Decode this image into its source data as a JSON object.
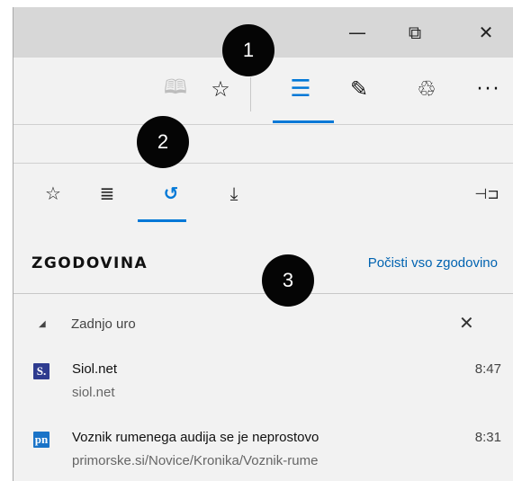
{
  "window_controls": {
    "minimize_icon": "minimize-icon",
    "restore_icon": "restore-icon",
    "close_icon": "close-icon",
    "minimize_glyph": "—",
    "restore_glyph": "⧉",
    "close_glyph": "✕"
  },
  "toolbar": {
    "reading_glyph": "🕮",
    "favorite_glyph": "☆",
    "hub_glyph": "☰",
    "note_glyph": "✎",
    "share_glyph": "♲",
    "more_glyph": "···",
    "accent": "#0078d7"
  },
  "hub_tabs": {
    "favorites_glyph": "☆",
    "reading_list_glyph": "≣",
    "history_glyph": "↺",
    "downloads_glyph": "⤓",
    "pin_glyph": "⊣⊐",
    "active": "history"
  },
  "panel": {
    "title": "ZGODOVINA",
    "clear_link": "Počisti vso zgodovino"
  },
  "group": {
    "caret": "◢",
    "label": "Zadnjo uro",
    "close_glyph": "✕"
  },
  "history": [
    {
      "badge": "S.",
      "badge_color": "#2e3b8f",
      "title": "Siol.net",
      "url": "siol.net",
      "time": "8:47"
    },
    {
      "badge": "pn",
      "badge_color": "#1a73c7",
      "title": "Voznik rumenega audija se je neprostovo",
      "url": "primorske.si/Novice/Kronika/Voznik-rume",
      "time": "8:31"
    }
  ],
  "callouts": [
    "1",
    "2",
    "3"
  ]
}
